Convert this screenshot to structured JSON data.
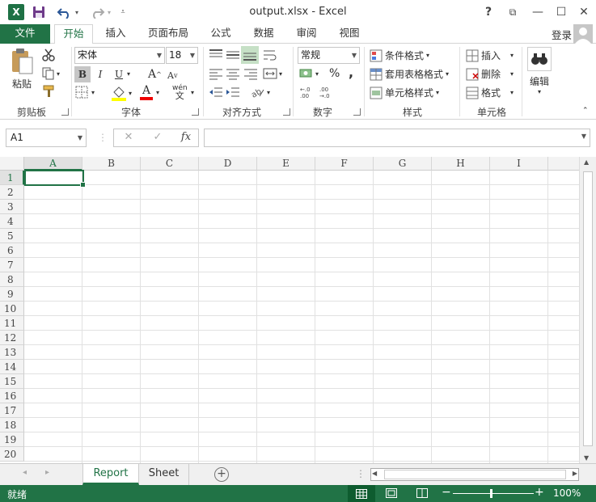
{
  "window": {
    "title": "output.xlsx - Excel",
    "help": "?",
    "restore_ribbon": "⧉",
    "minimize": "—",
    "maximize": "☐",
    "close": "✕"
  },
  "quick_access": {
    "logo_letter": "X"
  },
  "tabs": [
    {
      "label": "文件"
    },
    {
      "label": "开始"
    },
    {
      "label": "插入"
    },
    {
      "label": "页面布局"
    },
    {
      "label": "公式"
    },
    {
      "label": "数据"
    },
    {
      "label": "审阅"
    },
    {
      "label": "视图"
    }
  ],
  "account": {
    "login": "登录"
  },
  "ribbon": {
    "clipboard": {
      "label": "剪贴板",
      "paste": "粘贴"
    },
    "font": {
      "label": "字体",
      "font_name": "宋体",
      "font_size": "18",
      "bold": "B",
      "italic": "I",
      "underline": "U",
      "grow": "A",
      "shrink": "A",
      "font_color": "A",
      "phonetic": "wén"
    },
    "alignment": {
      "label": "对齐方式"
    },
    "number": {
      "label": "数字",
      "format": "常规",
      "percent": "%",
      "comma": ","
    },
    "styles": {
      "label": "样式",
      "conditional": "条件格式",
      "table": "套用表格格式",
      "cell_styles": "单元格样式"
    },
    "cells": {
      "label": "单元格",
      "insert": "插入",
      "delete": "删除",
      "format": "格式"
    },
    "editing": {
      "label": "编辑"
    }
  },
  "formula_bar": {
    "name_box": "A1",
    "cancel": "✕",
    "enter": "✓",
    "fx": "fx",
    "value": ""
  },
  "grid": {
    "columns": [
      "A",
      "B",
      "C",
      "D",
      "E",
      "F",
      "G",
      "H",
      "I"
    ],
    "rows": [
      "1",
      "2",
      "3",
      "4",
      "5",
      "6",
      "7",
      "8",
      "9",
      "10",
      "11",
      "12",
      "13",
      "14",
      "15",
      "16",
      "17",
      "18",
      "19",
      "20"
    ],
    "selected_cell": "A1"
  },
  "sheets": [
    {
      "label": "Report",
      "active": true
    },
    {
      "label": "Sheet",
      "active": false
    }
  ],
  "status": {
    "ready": "就绪",
    "zoom": "100%",
    "zoom_minus": "−",
    "zoom_plus": "+"
  },
  "colors": {
    "accent": "#217346"
  }
}
